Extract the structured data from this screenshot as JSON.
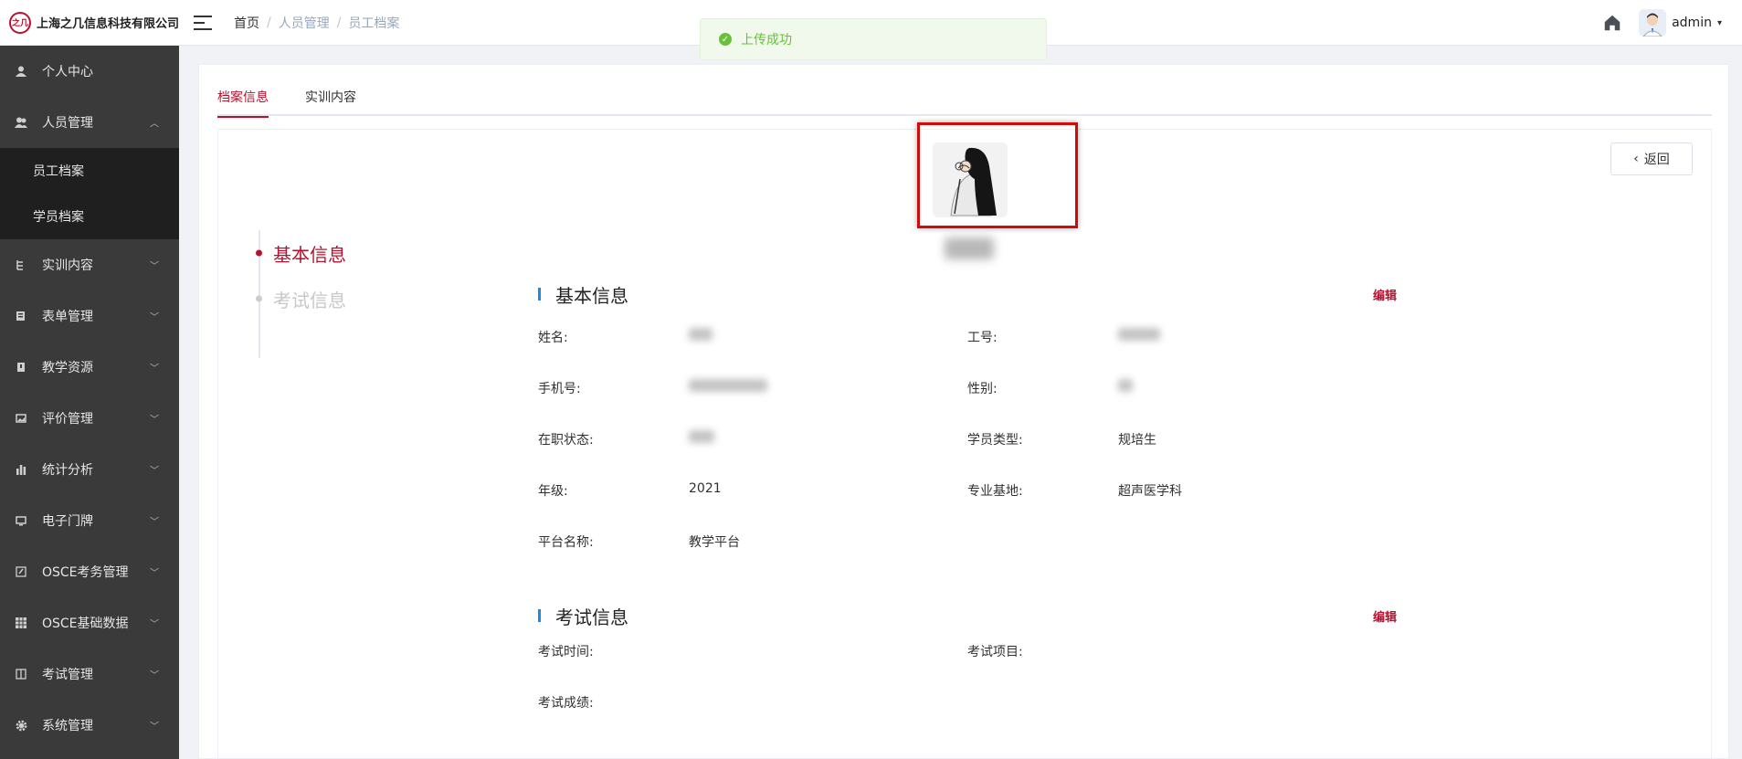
{
  "header": {
    "logo_mark": "之几",
    "company": "上海之几信息科技有限公司",
    "breadcrumb": [
      "首页",
      "人员管理",
      "员工档案"
    ],
    "username": "admin"
  },
  "toast": {
    "message": "上传成功",
    "type": "success",
    "color": "#67c23a"
  },
  "sidebar": {
    "items": [
      {
        "label": "个人中心",
        "icon": "user-icon"
      },
      {
        "label": "人员管理",
        "icon": "people-icon",
        "expanded": true,
        "children": [
          "员工档案",
          "学员档案"
        ]
      },
      {
        "label": "实训内容",
        "icon": "tree-icon"
      },
      {
        "label": "表单管理",
        "icon": "form-icon"
      },
      {
        "label": "教学资源",
        "icon": "book-icon"
      },
      {
        "label": "评价管理",
        "icon": "image-icon"
      },
      {
        "label": "统计分析",
        "icon": "bar-chart-icon"
      },
      {
        "label": "电子门牌",
        "icon": "monitor-icon"
      },
      {
        "label": "OSCE考务管理",
        "icon": "edit-icon"
      },
      {
        "label": "OSCE基础数据",
        "icon": "grid-icon"
      },
      {
        "label": "考试管理",
        "icon": "columns-icon"
      },
      {
        "label": "系统管理",
        "icon": "gear-icon"
      }
    ]
  },
  "tabs": [
    "档案信息",
    "实训内容"
  ],
  "profile": {
    "back_label": "返回",
    "anchors": [
      "基本信息",
      "考试信息"
    ],
    "basic": {
      "title": "基本信息",
      "edit": "编辑",
      "rows": [
        [
          {
            "label": "姓名:",
            "value": ""
          },
          {
            "label": "工号:",
            "value": ""
          }
        ],
        [
          {
            "label": "手机号:",
            "value": ""
          },
          {
            "label": "性别:",
            "value": ""
          }
        ],
        [
          {
            "label": "在职状态:",
            "value": ""
          },
          {
            "label": "学员类型:",
            "value": "规培生"
          }
        ],
        [
          {
            "label": "年级:",
            "value": "2021"
          },
          {
            "label": "专业基地:",
            "value": "超声医学科"
          }
        ],
        [
          {
            "label": "平台名称:",
            "value": "教学平台"
          }
        ]
      ]
    },
    "exam": {
      "title": "考试信息",
      "edit": "编辑",
      "rows": [
        [
          {
            "label": "考试时间:",
            "value": ""
          },
          {
            "label": "考试项目:",
            "value": ""
          }
        ],
        [
          {
            "label": "考试成绩:",
            "value": ""
          }
        ]
      ]
    }
  },
  "colors": {
    "brand": "#b5122f",
    "sidebar_bg": "#3a3a3a",
    "section_bar": "#1e88e5",
    "highlight": "#d10a0a"
  }
}
